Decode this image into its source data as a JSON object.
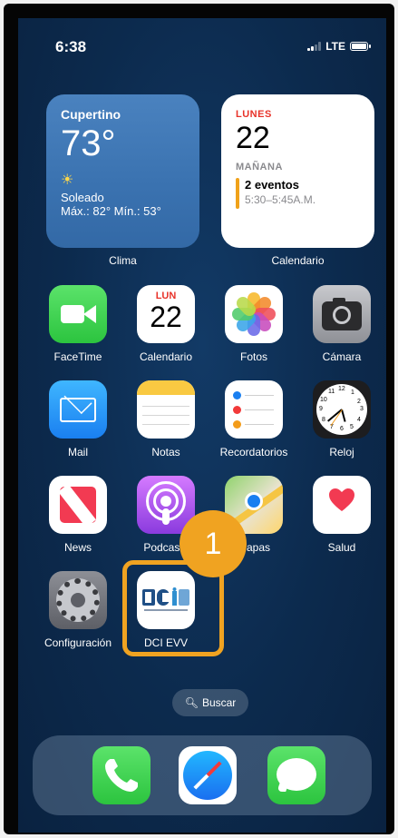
{
  "status_bar": {
    "time": "6:38",
    "network": "LTE"
  },
  "widgets": {
    "weather": {
      "city": "Cupertino",
      "temperature": "73°",
      "condition": "Soleado",
      "range": "Máx.: 82° Mín.: 53°",
      "label": "Clima"
    },
    "calendar": {
      "weekday": "LUNES",
      "day": "22",
      "section": "MAÑANA",
      "event_title": "2 eventos",
      "event_time": "5:30–5:45A.M.",
      "label": "Calendario"
    }
  },
  "apps": [
    {
      "label": "FaceTime",
      "icon": "facetime-icon"
    },
    {
      "label": "Calendario",
      "icon": "calendar-icon",
      "weekday": "LUN",
      "day": "22"
    },
    {
      "label": "Fotos",
      "icon": "photos-icon"
    },
    {
      "label": "Cámara",
      "icon": "camera-icon"
    },
    {
      "label": "Mail",
      "icon": "mail-icon"
    },
    {
      "label": "Notas",
      "icon": "notes-icon"
    },
    {
      "label": "Recordatorios",
      "icon": "reminders-icon"
    },
    {
      "label": "Reloj",
      "icon": "clock-icon",
      "clock_numbers": [
        "12",
        "1",
        "2",
        "3",
        "4",
        "5",
        "6",
        "7",
        "8",
        "9",
        "10",
        "11"
      ]
    },
    {
      "label": "News",
      "icon": "news-icon"
    },
    {
      "label": "Podcasts",
      "icon": "podcasts-icon"
    },
    {
      "label": "Mapas",
      "icon": "maps-icon"
    },
    {
      "label": "Salud",
      "icon": "health-icon"
    },
    {
      "label": "Configuración",
      "icon": "settings-icon"
    },
    {
      "label": "DCI EVV",
      "icon": "dci-evv-icon"
    }
  ],
  "annotation": {
    "step_number": "1",
    "color": "#f0a321"
  },
  "search": {
    "label": "Buscar",
    "icon": "search-icon"
  },
  "dock": [
    {
      "icon": "phone-icon"
    },
    {
      "icon": "safari-icon"
    },
    {
      "icon": "messages-icon"
    }
  ],
  "colors": {
    "wallpaper": "#0c2a4d",
    "accent_red": "#e8332a",
    "event_bar": "#f0a21a"
  }
}
